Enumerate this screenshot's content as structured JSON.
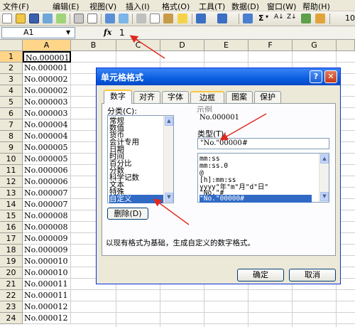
{
  "menubar": {
    "items": [
      "文件(F)",
      "编辑(E)",
      "视图(V)",
      "插入(I)",
      "格式(O)",
      "工具(T)",
      "数据(D)",
      "窗口(W)",
      "帮助(H)"
    ]
  },
  "toolbar": {
    "sigma": "Σ",
    "sigma_arrow": "▾",
    "sort_asc": "A↓",
    "sort_desc": "Z↓",
    "zoom": "10"
  },
  "formula_bar": {
    "cell_name": "A1",
    "fx": "fx",
    "value": "1"
  },
  "grid": {
    "columns": [
      "A",
      "B",
      "C",
      "D",
      "E",
      "F",
      "G"
    ],
    "rows": [
      {
        "n": "1",
        "a": "No.000001"
      },
      {
        "n": "2",
        "a": "No.000001"
      },
      {
        "n": "3",
        "a": "No.000002"
      },
      {
        "n": "4",
        "a": "No.000002"
      },
      {
        "n": "5",
        "a": "No.000003"
      },
      {
        "n": "6",
        "a": "No.000003"
      },
      {
        "n": "7",
        "a": "No.000004"
      },
      {
        "n": "8",
        "a": "No.000004"
      },
      {
        "n": "9",
        "a": "No.000005"
      },
      {
        "n": "10",
        "a": "No.000005"
      },
      {
        "n": "11",
        "a": "No.000006"
      },
      {
        "n": "12",
        "a": "No.000006"
      },
      {
        "n": "13",
        "a": "No.000007"
      },
      {
        "n": "14",
        "a": "No.000007"
      },
      {
        "n": "15",
        "a": "No.000008"
      },
      {
        "n": "16",
        "a": "No.000008"
      },
      {
        "n": "17",
        "a": "No.000009"
      },
      {
        "n": "18",
        "a": "No.000009"
      },
      {
        "n": "19",
        "a": "No.000010"
      },
      {
        "n": "20",
        "a": "No.000010"
      },
      {
        "n": "21",
        "a": "No.000011"
      },
      {
        "n": "22",
        "a": "No.000011"
      },
      {
        "n": "23",
        "a": "No.000012"
      },
      {
        "n": "24",
        "a": "No.000012"
      }
    ]
  },
  "dialog": {
    "title": "单元格格式",
    "help": "?",
    "close": "✕",
    "tabs": [
      "数字",
      "对齐",
      "字体",
      "边框",
      "图案",
      "保护"
    ],
    "category_label": "分类(C):",
    "categories": [
      "常规",
      "数值",
      "货币",
      "会计专用",
      "日期",
      "时间",
      "百分比",
      "分数",
      "科学记数",
      "文本",
      "特殊",
      "自定义"
    ],
    "selected_category": "自定义",
    "sample_label": "示例",
    "sample_value": "No.000001",
    "type_label": "类型(T):",
    "type_value": "\"No.\"00000#",
    "formats": [
      "mm:ss",
      "mm:ss.0",
      "@",
      "[h]:mm:ss",
      "yyyy\"年\"m\"月\"d\"日\"",
      "\"No.\"#",
      "\"No.\"00000#"
    ],
    "selected_format": "\"No.\"00000#",
    "delete_label": "删除(D)",
    "description": "以现有格式为基础，生成自定义的数字格式。",
    "ok_label": "确定",
    "cancel_label": "取消"
  }
}
